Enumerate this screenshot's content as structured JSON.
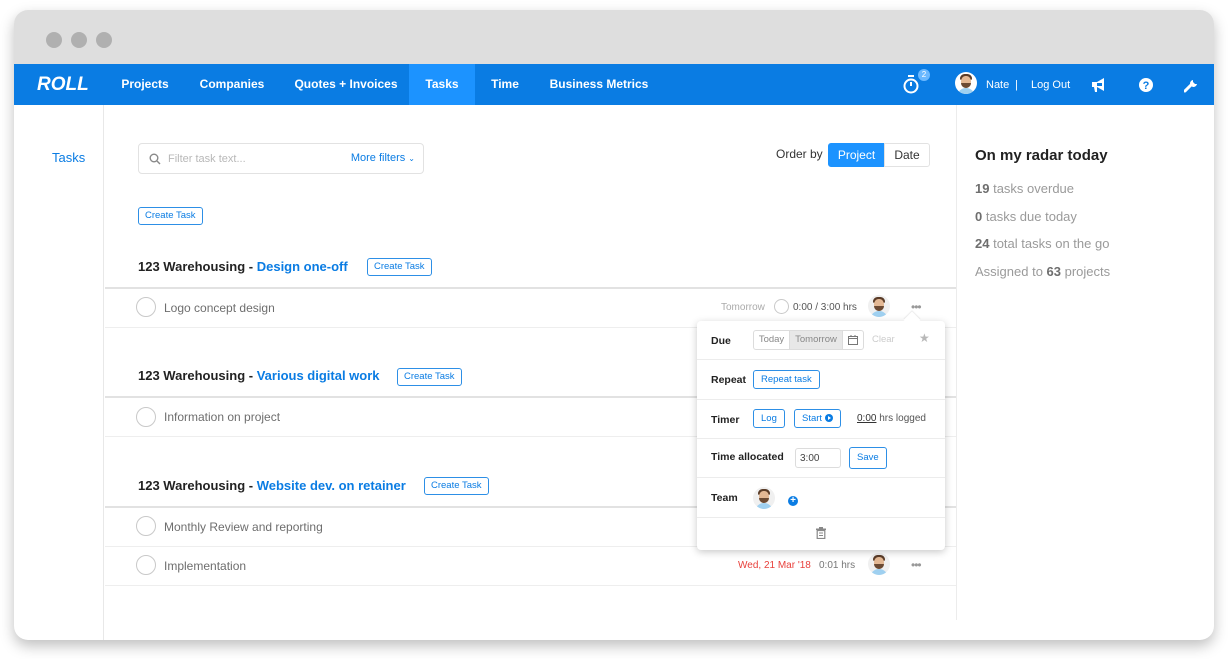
{
  "window": {
    "controls": [
      "close",
      "minimize",
      "maximize"
    ]
  },
  "nav": {
    "logo": "ROLL",
    "items": [
      {
        "label": "Projects",
        "active": false
      },
      {
        "label": "Companies",
        "active": false
      },
      {
        "label": "Quotes + Invoices",
        "active": false
      },
      {
        "label": "Tasks",
        "active": true
      },
      {
        "label": "Time",
        "active": false
      },
      {
        "label": "Business Metrics",
        "active": false
      }
    ],
    "timer_badge": "2",
    "user_name": "Nate",
    "separator": "|",
    "logout": "Log Out",
    "icons": [
      "stopwatch-icon",
      "megaphone-icon",
      "help-icon",
      "wrench-icon"
    ],
    "accent": "#0a7ce3",
    "active_bg": "#1c93ff"
  },
  "sidebar": {
    "label": "Tasks"
  },
  "filter": {
    "placeholder": "Filter task text...",
    "more_filters": "More filters",
    "create_task": "Create Task"
  },
  "order": {
    "label": "Order by",
    "options": [
      "Project",
      "Date"
    ],
    "selected": "Project"
  },
  "groups": [
    {
      "client": "123 Warehousing",
      "dash": " - ",
      "project": "Design one-off",
      "create": "Create Task",
      "tasks": [
        {
          "name": "Logo concept design",
          "due": "Tomorrow",
          "time": "0:00 / 3:00 hrs"
        }
      ]
    },
    {
      "client": "123 Warehousing",
      "dash": " - ",
      "project": "Various digital work",
      "create": "Create Task",
      "tasks": [
        {
          "name": "Information on project"
        }
      ]
    },
    {
      "client": "123 Warehousing",
      "dash": " - ",
      "project": "Website dev. on retainer",
      "create": "Create Task",
      "tasks": [
        {
          "name": "Monthly Review and reporting"
        },
        {
          "name": "Implementation",
          "due": "Wed, 21 Mar '18",
          "time": "0:01 hrs",
          "due_color": "#e8413c"
        }
      ]
    }
  ],
  "popover": {
    "due_label": "Due",
    "due_options": [
      "Today",
      "Tomorrow"
    ],
    "due_selected": "Tomorrow",
    "clear": "Clear",
    "repeat_label": "Repeat",
    "repeat_button": "Repeat task",
    "timer_label": "Timer",
    "log_button": "Log",
    "start_button": "Start",
    "logged_value": "0:00",
    "logged_suffix": " hrs logged",
    "time_alloc_label": "Time allocated",
    "time_alloc_value": "3:00",
    "save_button": "Save",
    "team_label": "Team"
  },
  "radar": {
    "title": "On my radar today",
    "items": [
      {
        "num": "19",
        "text": " tasks overdue"
      },
      {
        "num": "0",
        "text": " tasks due today"
      },
      {
        "num": "24",
        "text": " total tasks on the go"
      },
      {
        "prefix": "Assigned to ",
        "num": "63",
        "text": " projects"
      }
    ]
  }
}
